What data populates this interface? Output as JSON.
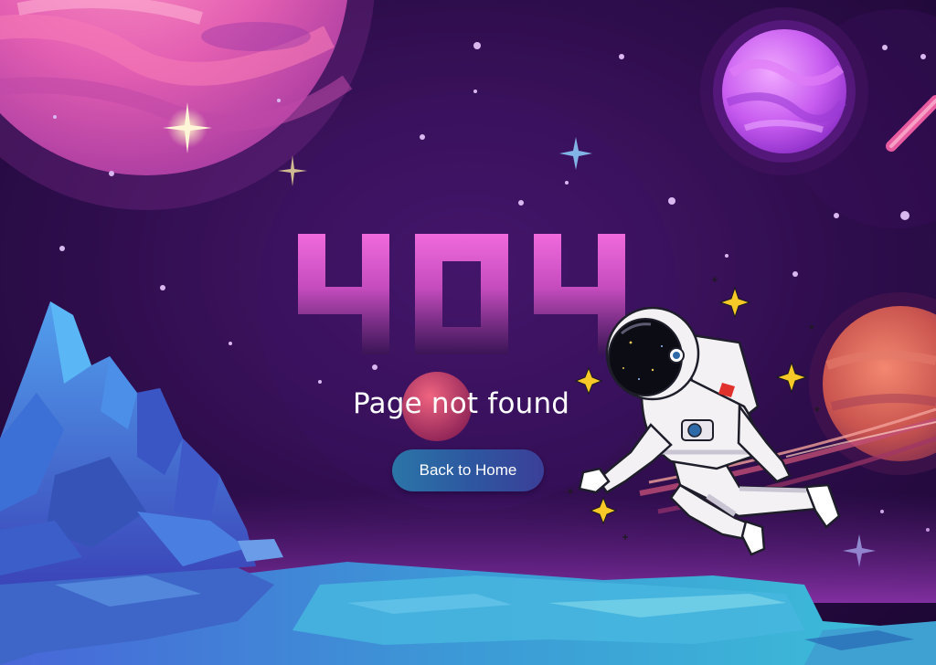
{
  "error": {
    "code": "404",
    "message": "Page not found"
  },
  "actions": {
    "home_label": "Back to Home"
  },
  "colors": {
    "sky": "#2a0c45",
    "code_top": "#e85ad8",
    "code_bottom": "#3a1555",
    "button_start": "#2b75a8",
    "button_end": "#3b3f98",
    "rocks": "#3b7fd6",
    "sparkle": "#f7c928"
  },
  "illustrations": {
    "planets": [
      "pink-planet-icon",
      "violet-planet-icon",
      "ringed-planet-icon",
      "small-red-planet-icon"
    ],
    "figure": "astronaut-icon",
    "terrain": "crystal-rocks-icon"
  }
}
